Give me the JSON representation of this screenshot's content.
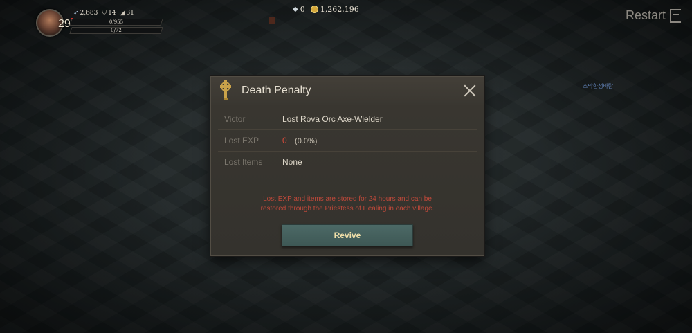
{
  "hud": {
    "level": "29",
    "stats": [
      {
        "icon": "feather-icon",
        "value": "2,683"
      },
      {
        "icon": "helmet-icon",
        "value": "14"
      },
      {
        "icon": "boot-icon",
        "value": "31"
      }
    ],
    "hp_text": "0/955",
    "mp_text": "0/72",
    "hp_fill": 0,
    "mp_fill": 0
  },
  "currency": {
    "gems": "0",
    "gold": "1,262,196"
  },
  "restart_label": "Restart",
  "world_label": "소막한생바람",
  "dialog": {
    "title": "Death Penalty",
    "rows": [
      {
        "label": "Victor",
        "value": "Lost Rova Orc Axe-Wielder"
      },
      {
        "label": "Lost EXP",
        "value": "0",
        "extra": "(0.0%)"
      },
      {
        "label": "Lost Items",
        "value": "None"
      }
    ],
    "notice_line1": "Lost EXP and items are stored for 24 hours and can be",
    "notice_line2": "restored through the Priestess of Healing in each village.",
    "revive_label": "Revive"
  },
  "colors": {
    "accent_gold": "#f0dfa9",
    "warning_red": "#c0493a",
    "button_teal": "#4c6966"
  }
}
